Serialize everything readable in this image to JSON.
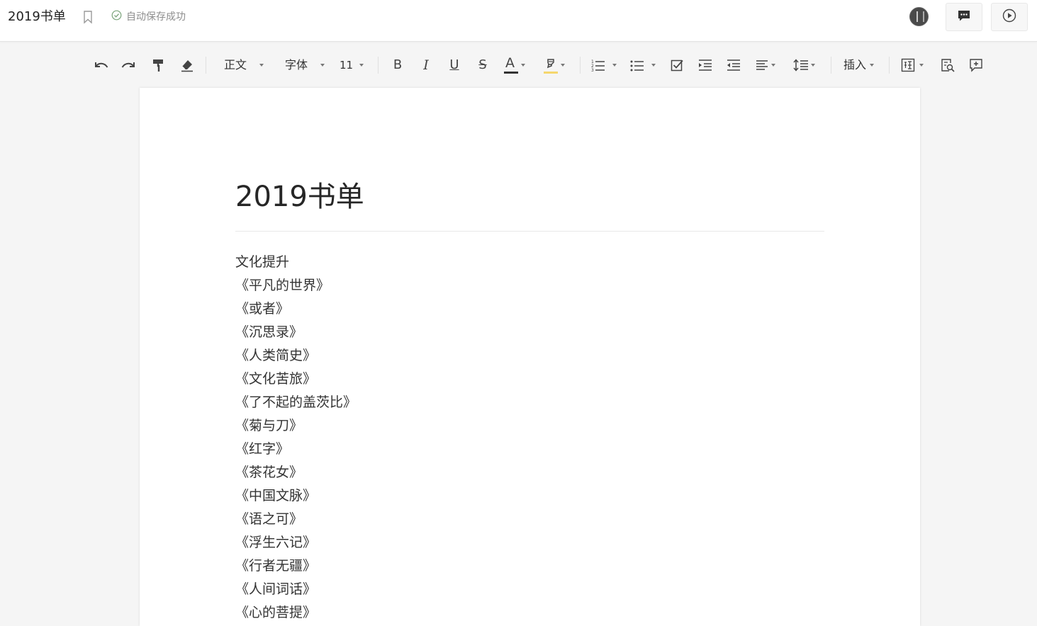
{
  "header": {
    "doc_name": "2019书单",
    "save_status": "自动保存成功"
  },
  "toolbar": {
    "style_label": "正文",
    "font_label": "字体",
    "size_label": "11",
    "insert_label": "插入",
    "bold": "B",
    "italic": "I",
    "underline": "U",
    "strike": "S",
    "font_color_letter": "A",
    "font_color": "#333333",
    "highlight_color": "#f5d76e"
  },
  "document": {
    "title": "2019书单",
    "lines": [
      "文化提升",
      "《平凡的世界》",
      "《或者》",
      "《沉思录》",
      "《人类简史》",
      "《文化苦旅》",
      "《了不起的盖茨比》",
      "《菊与刀》",
      "《红字》",
      "《茶花女》",
      "《中国文脉》",
      "《语之可》",
      "《浮生六记》",
      "《行者无疆》",
      "《人间词话》",
      "《心的菩提》"
    ]
  },
  "icons": {
    "bookmark": "bookmark-icon",
    "save_ok": "check-circle-icon",
    "comment": "comment-icon",
    "present": "play-circle-icon"
  }
}
